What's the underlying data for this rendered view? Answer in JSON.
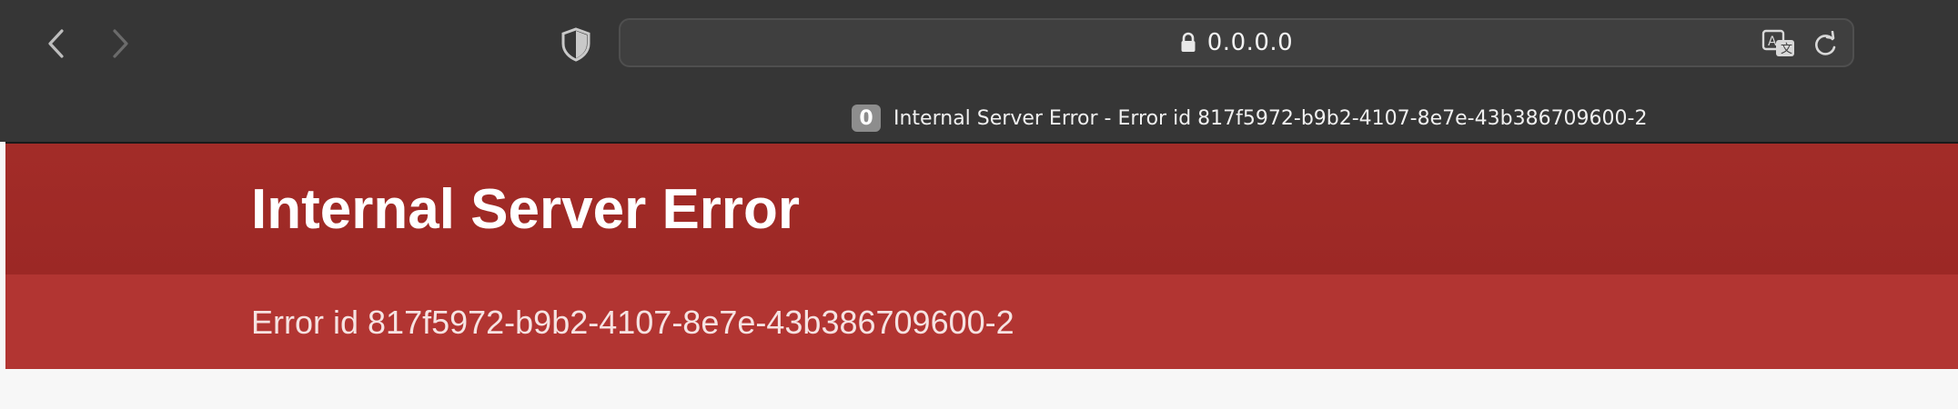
{
  "browser": {
    "url": "0.0.0.0",
    "tab": {
      "badge": "0",
      "title": "Internal Server Error - Error id 817f5972-b9b2-4107-8e7e-43b386709600-2"
    },
    "icons": {
      "back": "chevron-left-icon",
      "forward": "chevron-right-icon",
      "privacy": "shield-icon",
      "secure": "lock-icon",
      "translate": "translate-icon",
      "reload": "reload-icon"
    }
  },
  "page": {
    "title": "Internal Server Error",
    "error_id": "Error id 817f5972-b9b2-4107-8e7e-43b386709600-2"
  },
  "colors": {
    "chrome": "#363636",
    "header_red": "#a02a27",
    "sub_red": "#b23532",
    "body_bg": "#f7f7f7"
  }
}
